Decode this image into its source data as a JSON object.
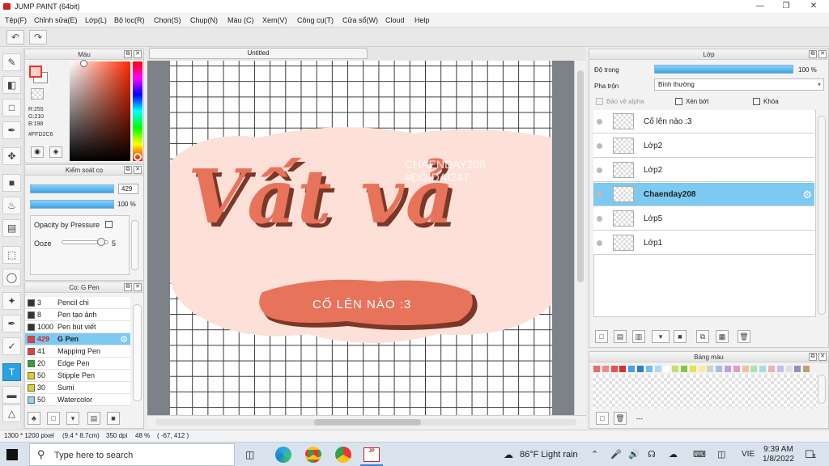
{
  "app": {
    "title": "JUMP PAINT (64bit)"
  },
  "window": {
    "minimize_icon": "minimize-icon",
    "maximize_icon": "restore-icon",
    "close_icon": "close-icon"
  },
  "menu": [
    "Tệp(F)",
    "Chỉnh sửa(E)",
    "Lớp(L)",
    "Bộ lọc(R)",
    "Chọn(S)",
    "Chụp(N)",
    "Màu (C)",
    "Xem(V)",
    "Công cụ(T)",
    "Cửa sổ(W)",
    "Cloud",
    "Help"
  ],
  "color_panel": {
    "title": "Màu",
    "r": "R:255",
    "g": "G:210",
    "b": "B:198",
    "hex": "#FFD2C6",
    "fg": "#FFD2C6",
    "bg": "#FFFFFF"
  },
  "brush_control": {
    "title": "Kiểm soát cọ",
    "size": "429",
    "opacity": "100 %",
    "pressure_label": "Opacity by Pressure",
    "ooze_label": "Ooze",
    "ooze_value": "5",
    "ooze_level": 0.9
  },
  "brush_list": {
    "title": "Cọ: G Pen",
    "items": [
      {
        "size": "3",
        "label": "Pencil chì",
        "color": "#333333"
      },
      {
        "size": "8",
        "label": "Pen tạo ảnh",
        "color": "#333333"
      },
      {
        "size": "1000",
        "label": "Pen bút viết",
        "color": "#333333"
      },
      {
        "size": "429",
        "label": "G Pen",
        "color": "#e83c3c",
        "selected": true
      },
      {
        "size": "41",
        "label": "Mapping Pen",
        "color": "#e83c3c"
      },
      {
        "size": "20",
        "label": "Edge Pen",
        "color": "#2aa72a"
      },
      {
        "size": "50",
        "label": "Stipple Pen",
        "color": "#e0d21a"
      },
      {
        "size": "30",
        "label": "Sumi",
        "color": "#e0d21a"
      },
      {
        "size": "50",
        "label": "Watercolor",
        "color": "#8fd3f0"
      }
    ]
  },
  "canvas": {
    "tab": "Untitled",
    "art_main": "Vất vả",
    "art_sub": "CỐ LÊN NÀO :3",
    "watermark1": "CHAENDAY208",
    "watermark2": "#ĐÓIDAI247"
  },
  "layers_panel": {
    "title": "Lớp",
    "opacity_label": "Độ trong",
    "opacity_value": "100 %",
    "opacity_level": 1.0,
    "blend_label": "Pha trộn",
    "blend_value": "Bình thường",
    "protect_alpha": "Bảo vệ alpha",
    "clip": "Xén bớt",
    "lock": "Khóa",
    "layers": [
      {
        "name": "Cố lên nào :3"
      },
      {
        "name": "Lớp2"
      },
      {
        "name": "Lớp2"
      },
      {
        "name": "Chaenday208",
        "selected": true
      },
      {
        "name": "Lớp5"
      },
      {
        "name": "Lớp1"
      }
    ]
  },
  "palette": {
    "title": "Bảng màu",
    "swatches": [
      "#f06a6a",
      "#f08a8a",
      "#e85050",
      "#d83030",
      "#4aa0e0",
      "#2f7fd0",
      "#70c0f0",
      "#b0d8f0",
      "#ffffff",
      "#c0e070",
      "#80c840",
      "#f0e050",
      "#f0f0a0",
      "#d0d0d0",
      "#a0c0e0",
      "#c0a0e0",
      "#e0a0c0",
      "#f0c0a0",
      "#b0e0b0",
      "#a0e0e0",
      "#f0b0b0",
      "#c0c0f0",
      "#e0e0e0",
      "#9090c0",
      "#c0a070"
    ],
    "menu_text": "---"
  },
  "status": {
    "size": "1300 * 1200 pixel",
    "cm": "(9.4 * 8.7cm)",
    "dpi": "350 dpi",
    "zoom": "48 %",
    "coords": "( -67, 412 )"
  },
  "taskbar": {
    "search": "Type here to search",
    "weather": "86°F  Light rain",
    "lang": "VIE",
    "time": "9:39 AM",
    "date": "1/8/2022",
    "notif": "1"
  }
}
